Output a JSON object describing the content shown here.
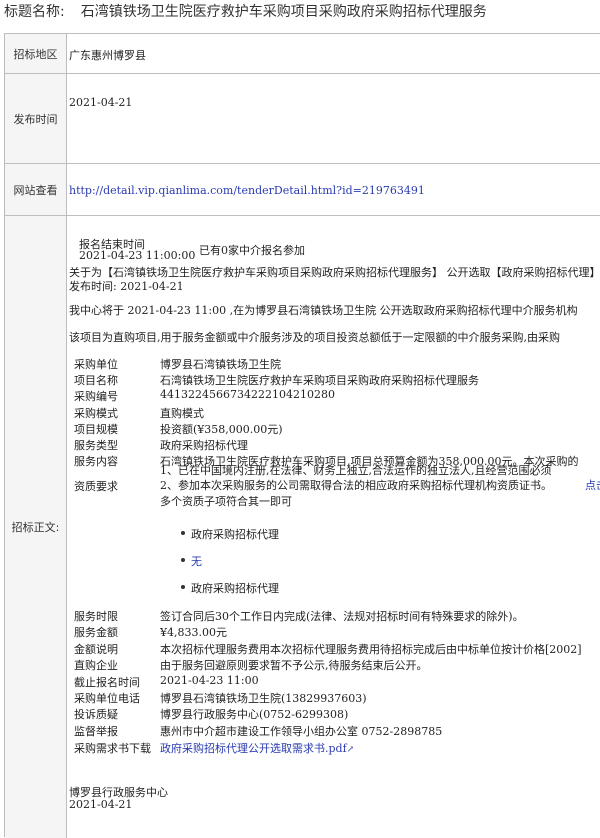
{
  "title": {
    "label": "标题名称:",
    "text": "石湾镇铁场卫生院医疗救护车采购项目采购政府采购招标代理服务"
  },
  "rows": {
    "region": {
      "label": "招标地区",
      "value": "广东惠州博罗县"
    },
    "publish": {
      "label": "发布时间",
      "value": "2021-04-21"
    },
    "url": {
      "label": "网站查看",
      "value": "http://detail.vip.qianlima.com/tenderDetail.html?id=219763491"
    },
    "body_label": "招标正文:"
  },
  "content": {
    "deadline_title": "报名结束时间",
    "deadline_time": "2021-04-23 11:00:00",
    "agents_joined": "已有0家中介报名参加",
    "intro_line": "关于为【石湾镇铁场卫生院医疗救护车采购项目采购政府采购招标代理服务】 公开选取【政府采购招标代理】",
    "publish_line": "发布时间:  2021-04-21",
    "para1": "我中心将于 2021-04-23 11:00 ,在为博罗县石湾镇铁场卫生院 公开选取政府采购招标代理中介服务机构",
    "para2": "该项目为直购项目,用于服务金额或中介服务涉及的项目投资总额低于一定限额的中介服务采购,由采购",
    "details": [
      {
        "k": "采购单位",
        "v": "博罗县石湾镇铁场卫生院"
      },
      {
        "k": "项目名称",
        "v": "石湾镇铁场卫生院医疗救护车采购项目采购政府采购招标代理服务"
      },
      {
        "k": "采购编号",
        "v": "441322456673422210421028​0"
      },
      {
        "k": "采购模式",
        "v": "直购模式"
      },
      {
        "k": "项目规模",
        "v": "投资额(¥358,000.00元)"
      },
      {
        "k": "服务类型",
        "v": "政府采购招标代理"
      },
      {
        "k": "服务内容",
        "v": "石湾镇铁场卫生院医疗救护车采购项目,项目总预算金额为358,000.00元。本次采购的"
      }
    ],
    "qualification_label": "资质要求",
    "qualification_lines": [
      "1、已在中国境内注册,在法律、财务上独立,合法运作的独立法人,且经营范围必须",
      "2、参加本次采购服务的公司需取得合法的相应政府采购招标代理机构资质证书。"
    ],
    "qualification_more": "点击",
    "qualification_note": "多个资质子项符合其一即可",
    "qualification_items": [
      "政府采购招标代理",
      "无",
      "政府采购招标代理"
    ],
    "details2": [
      {
        "k": "服务时限",
        "v": "签订合同后30个工作日内完成(法律、法规对招标时间有特殊要求的除外)。"
      },
      {
        "k": "服务金额",
        "v": "¥4,833.00元"
      },
      {
        "k": "金额说明",
        "v": "本次招标代理服务费用本次招标代理服务费用待招标完成后由中标单位按计价格[2002]"
      },
      {
        "k": "直购企业",
        "v": "由于服务回避原则要求暂不予公示,待服务结束后公开。"
      },
      {
        "k": "截止报名时间",
        "v": "2021-04-23 11:00"
      },
      {
        "k": "采购单位电话",
        "v": "博罗县石湾镇铁场卫生院(13829937603)"
      },
      {
        "k": "投诉质疑",
        "v": "博罗县行政服务中心(0752-6299308)"
      },
      {
        "k": "监督举报",
        "v": "惠州市中介超市建设工作领导小组办公室 0752-2898785"
      }
    ],
    "download_label": "采购需求书下载",
    "download_link": "政府采购招标代理公开选取需求书.pdf",
    "download_icon": "external-link-icon",
    "footer_org": "博罗县行政服务中心",
    "footer_date": "2021-04-21"
  }
}
